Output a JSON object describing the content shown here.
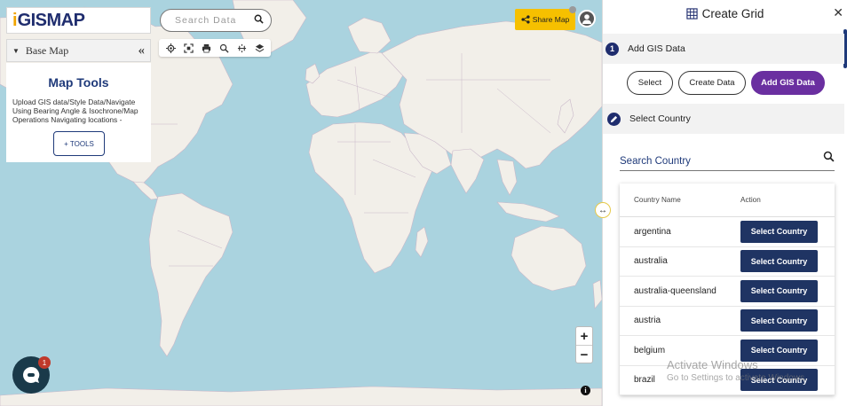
{
  "map": {
    "logo": {
      "prefix": "i",
      "text": "GISMAP"
    },
    "base_map_label": "Base Map",
    "collapse_symbol": "«",
    "tools_panel": {
      "title": "Map Tools",
      "description": "Upload GIS data/Style Data/Navigate Using Bearing Angle & Isochrone/Map Operations Navigating locations -",
      "button_label": "+ TOOLS"
    },
    "search": {
      "placeholder": "Search Data",
      "icon": "search-icon"
    },
    "toolbar_icons": [
      "locate-icon",
      "fullscreen-icon",
      "print-icon",
      "zoom-search-icon",
      "measure-icon",
      "layers-icon"
    ],
    "share_label": "Share Map",
    "zoom": {
      "in": "+",
      "out": "−"
    },
    "info_label": "i",
    "chat_badge": "1",
    "resize_symbol": "↔"
  },
  "panel": {
    "title": "Create Grid",
    "close_symbol": "✕",
    "step1": {
      "number": "1",
      "label": "Add GIS Data"
    },
    "buttons": {
      "select": "Select",
      "create": "Create Data",
      "add": "Add GIS Data"
    },
    "step2": {
      "label": "Select Country"
    },
    "country_search_placeholder": "Search Country",
    "table": {
      "headers": {
        "name": "Country Name",
        "action": "Action"
      },
      "rows": [
        {
          "name": "argentina",
          "action": "Select Country"
        },
        {
          "name": "australia",
          "action": "Select Country"
        },
        {
          "name": "australia-queensland",
          "action": "Select Country"
        },
        {
          "name": "austria",
          "action": "Select Country"
        },
        {
          "name": "belgium",
          "action": "Select Country"
        },
        {
          "name": "brazil",
          "action": "Select Country"
        }
      ]
    }
  },
  "watermark": {
    "line1": "Activate Windows",
    "line2": "Go to Settings to activate Windows."
  },
  "colors": {
    "accent": "#1f2d6e",
    "share": "#f6c000",
    "primary_button": "#6a2fa0",
    "select_button": "#1f3463",
    "water": "#aad3df",
    "land": "#f2efe9"
  }
}
